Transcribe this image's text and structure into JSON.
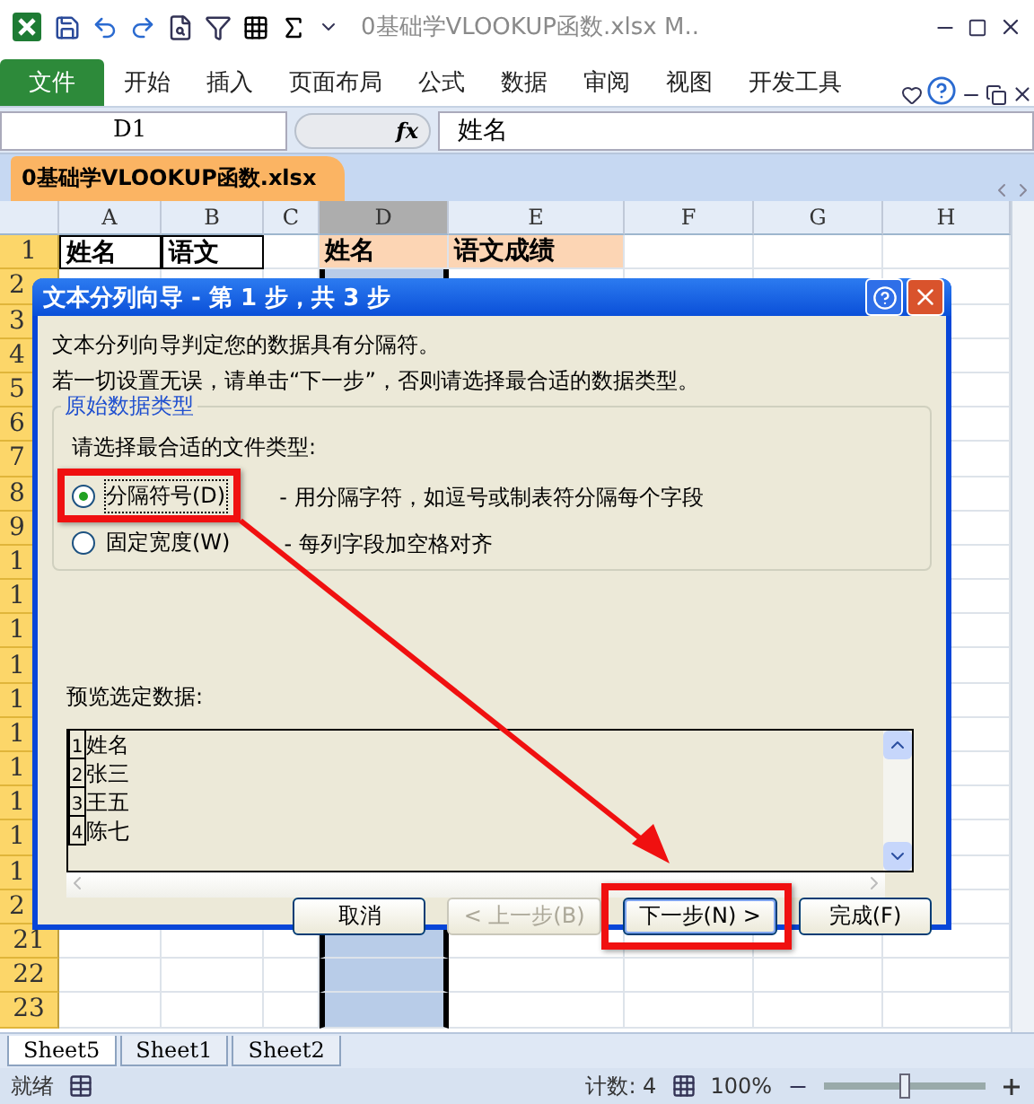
{
  "window": {
    "title": "0基础学VLOOKUP函数.xlsx M.."
  },
  "ribbon_tabs": [
    {
      "label": "文件",
      "kind": "file"
    },
    {
      "label": "开始",
      "kind": "tab"
    },
    {
      "label": "插入",
      "kind": "tab"
    },
    {
      "label": "页面布局",
      "kind": "tab"
    },
    {
      "label": "公式",
      "kind": "tab"
    },
    {
      "label": "数据",
      "kind": "tab"
    },
    {
      "label": "审阅",
      "kind": "tab"
    },
    {
      "label": "视图",
      "kind": "tab"
    },
    {
      "label": "开发工具",
      "kind": "tab"
    }
  ],
  "formula_bar": {
    "name_box": "D1",
    "fx": "fx",
    "value": "姓名"
  },
  "workbook_tab": "0基础学VLOOKUP函数.xlsx",
  "columns": [
    {
      "label": "A",
      "selected": false
    },
    {
      "label": "B",
      "selected": false
    },
    {
      "label": "C",
      "selected": false
    },
    {
      "label": "D",
      "selected": true
    },
    {
      "label": "E",
      "selected": false
    },
    {
      "label": "F",
      "selected": false
    },
    {
      "label": "G",
      "selected": false
    },
    {
      "label": "H",
      "selected": false
    }
  ],
  "row_1_cells": [
    {
      "text": "姓名",
      "kind": "plain"
    },
    {
      "text": "语文",
      "kind": "plain"
    },
    {
      "text": "姓名",
      "kind": "filled"
    },
    {
      "text": "语文成绩",
      "kind": "filled"
    }
  ],
  "row_labels": [
    "1",
    "2",
    "3",
    "4",
    "5",
    "6",
    "7",
    "8",
    "9",
    "1",
    "1",
    "1",
    "1",
    "1",
    "1",
    "1",
    "1",
    "1",
    "1",
    "2",
    "21",
    "22",
    "23"
  ],
  "dialog": {
    "title": "文本分列向导 - 第 1 步，共 3 步",
    "intro": [
      "文本分列向导判定您的数据具有分隔符。",
      "若一切设置无误，请单击“下一步”，否则请选择最合适的数据类型。"
    ],
    "group_title": "原始数据类型",
    "prompt": "请选择最合适的文件类型:",
    "options": [
      {
        "label": "分隔符号(D)",
        "description": "- 用分隔字符，如逗号或制表符分隔每个字段",
        "selected": true,
        "highlighted": true
      },
      {
        "label": "固定宽度(W)",
        "description": "- 每列字段加空格对齐",
        "selected": false,
        "highlighted": false
      }
    ],
    "preview_label": "预览选定数据:",
    "preview_rows": [
      {
        "number": "1",
        "text": "姓名"
      },
      {
        "number": "2",
        "text": "张三"
      },
      {
        "number": "3",
        "text": "王五"
      },
      {
        "number": "4",
        "text": "陈七"
      }
    ],
    "buttons": [
      {
        "label": "取消",
        "disabled": false,
        "highlighted": false
      },
      {
        "label": "< 上一步(B)",
        "disabled": true,
        "highlighted": false
      },
      {
        "label": "下一步(N) >",
        "disabled": false,
        "highlighted": true
      },
      {
        "label": "完成(F)",
        "disabled": false,
        "highlighted": false
      }
    ]
  },
  "annotation_arrow": true,
  "sheet_tabs": [
    {
      "label": "Sheet5",
      "selected": true
    },
    {
      "label": "Sheet1",
      "selected": false
    },
    {
      "label": "Sheet2",
      "selected": false
    }
  ],
  "status_bar": {
    "mode": "就绪",
    "count": "计数: 4",
    "zoom": "100%",
    "zoom_level": {
      "level": 0.5
    }
  }
}
